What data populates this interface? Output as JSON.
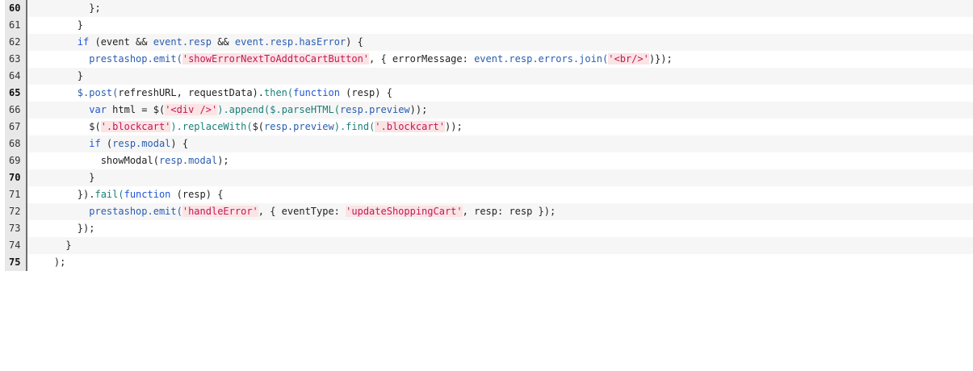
{
  "code_viewer": {
    "lines": [
      {
        "number": "60",
        "bold": true,
        "indent": 10,
        "tokens": [
          {
            "t": "};",
            "c": "plain"
          }
        ]
      },
      {
        "number": "61",
        "bold": false,
        "indent": 8,
        "tokens": [
          {
            "t": "}",
            "c": "plain"
          }
        ]
      },
      {
        "number": "62",
        "bold": false,
        "indent": 8,
        "tokens": [
          {
            "t": "if",
            "c": "kw"
          },
          {
            "t": " (event && ",
            "c": "plain"
          },
          {
            "t": "event.resp",
            "c": "prop"
          },
          {
            "t": " && ",
            "c": "plain"
          },
          {
            "t": "event.resp.hasError",
            "c": "prop"
          },
          {
            "t": ") {",
            "c": "plain"
          }
        ]
      },
      {
        "number": "63",
        "bold": false,
        "indent": 10,
        "tokens": [
          {
            "t": "prestashop.emit(",
            "c": "prop"
          },
          {
            "t": "'showErrorNextToAddtoCartButton'",
            "c": "str"
          },
          {
            "t": ", { errorMessage: ",
            "c": "plain"
          },
          {
            "t": "event.resp.errors.join(",
            "c": "prop"
          },
          {
            "t": "'<br/>'",
            "c": "str"
          },
          {
            "t": ")});",
            "c": "plain"
          }
        ]
      },
      {
        "number": "64",
        "bold": false,
        "indent": 8,
        "tokens": [
          {
            "t": "}",
            "c": "plain"
          }
        ]
      },
      {
        "number": "65",
        "bold": true,
        "indent": 8,
        "tokens": [
          {
            "t": "$.post(",
            "c": "prop"
          },
          {
            "t": "refreshURL, requestData).",
            "c": "plain"
          },
          {
            "t": "then(",
            "c": "fn"
          },
          {
            "t": "function",
            "c": "kw"
          },
          {
            "t": " (resp) {",
            "c": "plain"
          }
        ]
      },
      {
        "number": "66",
        "bold": false,
        "indent": 10,
        "tokens": [
          {
            "t": "var",
            "c": "kw"
          },
          {
            "t": " html = $(",
            "c": "plain"
          },
          {
            "t": "'<div />'",
            "c": "str"
          },
          {
            "t": ").append(",
            "c": "fn"
          },
          {
            "t": "$.parseHTML(",
            "c": "fn"
          },
          {
            "t": "resp.preview",
            "c": "prop"
          },
          {
            "t": "));",
            "c": "plain"
          }
        ]
      },
      {
        "number": "67",
        "bold": false,
        "indent": 10,
        "tokens": [
          {
            "t": "$(",
            "c": "plain"
          },
          {
            "t": "'.blockcart'",
            "c": "str"
          },
          {
            "t": ").replaceWith(",
            "c": "fn"
          },
          {
            "t": "$(",
            "c": "plain"
          },
          {
            "t": "resp.preview",
            "c": "prop"
          },
          {
            "t": ").find(",
            "c": "fn"
          },
          {
            "t": "'.blockcart'",
            "c": "str"
          },
          {
            "t": "));",
            "c": "plain"
          }
        ]
      },
      {
        "number": "68",
        "bold": false,
        "indent": 10,
        "tokens": [
          {
            "t": "if",
            "c": "kw"
          },
          {
            "t": " (",
            "c": "plain"
          },
          {
            "t": "resp.modal",
            "c": "prop"
          },
          {
            "t": ") {",
            "c": "plain"
          }
        ]
      },
      {
        "number": "69",
        "bold": false,
        "indent": 12,
        "tokens": [
          {
            "t": "showModal(",
            "c": "plain"
          },
          {
            "t": "resp.modal",
            "c": "prop"
          },
          {
            "t": ");",
            "c": "plain"
          }
        ]
      },
      {
        "number": "70",
        "bold": true,
        "indent": 10,
        "tokens": [
          {
            "t": "}",
            "c": "plain"
          }
        ]
      },
      {
        "number": "71",
        "bold": false,
        "indent": 8,
        "tokens": [
          {
            "t": "}).",
            "c": "plain"
          },
          {
            "t": "fail(",
            "c": "fn"
          },
          {
            "t": "function",
            "c": "kw"
          },
          {
            "t": " (resp) {",
            "c": "plain"
          }
        ]
      },
      {
        "number": "72",
        "bold": false,
        "indent": 10,
        "tokens": [
          {
            "t": "prestashop.emit(",
            "c": "prop"
          },
          {
            "t": "'handleError'",
            "c": "str"
          },
          {
            "t": ", { eventType: ",
            "c": "plain"
          },
          {
            "t": "'updateShoppingCart'",
            "c": "str"
          },
          {
            "t": ", resp: resp });",
            "c": "plain"
          }
        ]
      },
      {
        "number": "73",
        "bold": false,
        "indent": 8,
        "tokens": [
          {
            "t": "});",
            "c": "plain"
          }
        ]
      },
      {
        "number": "74",
        "bold": false,
        "indent": 6,
        "tokens": [
          {
            "t": "}",
            "c": "plain"
          }
        ]
      },
      {
        "number": "75",
        "bold": true,
        "indent": 4,
        "tokens": [
          {
            "t": ");",
            "c": "plain"
          }
        ]
      }
    ]
  }
}
